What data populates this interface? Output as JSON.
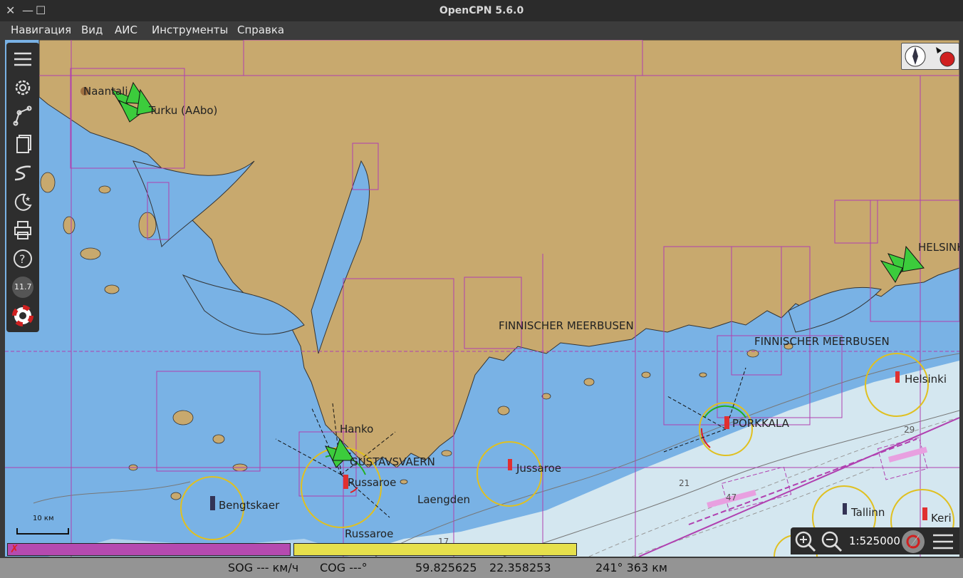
{
  "window": {
    "title": "OpenCPN 5.6.0"
  },
  "menu": [
    "Навигация",
    "Вид",
    "АИС",
    "Инструменты",
    "Справка"
  ],
  "toolbar": {
    "zoom_level": "11.7"
  },
  "chart": {
    "labels": [
      {
        "text": "Naantali"
      },
      {
        "text": "Turku (AAbo)"
      },
      {
        "text": "FINNISCHER MEERBUSEN"
      },
      {
        "text": "FINNISCHER MEERBUSEN"
      },
      {
        "text": "HELSINKI"
      },
      {
        "text": "Helsinki"
      },
      {
        "text": "PORKKALA"
      },
      {
        "text": "Hanko"
      },
      {
        "text": "GUSTAVSVAERN"
      },
      {
        "text": "Russaroe"
      },
      {
        "text": "Russaroe"
      },
      {
        "text": "Jussaroe"
      },
      {
        "text": "Laengden"
      },
      {
        "text": "Bengtskaer"
      },
      {
        "text": "Tallinn"
      },
      {
        "text": "Keri"
      }
    ],
    "depths": [
      "21",
      "29",
      "17",
      "47"
    ],
    "colors": {
      "land": "#c8a96e",
      "shallow": "#79b2e5",
      "deep": "#d4e7f0",
      "chart_border": "#b040b0",
      "light_ring": "#e0c020"
    }
  },
  "scale_bar": {
    "label": "10 км"
  },
  "zoom": {
    "scale": "1:525000"
  },
  "status": {
    "sog": "SOG --- км/ч",
    "cog": "COG ---°",
    "lat": "59.825625",
    "lon": "22.358253",
    "range": "241° 363 км"
  }
}
